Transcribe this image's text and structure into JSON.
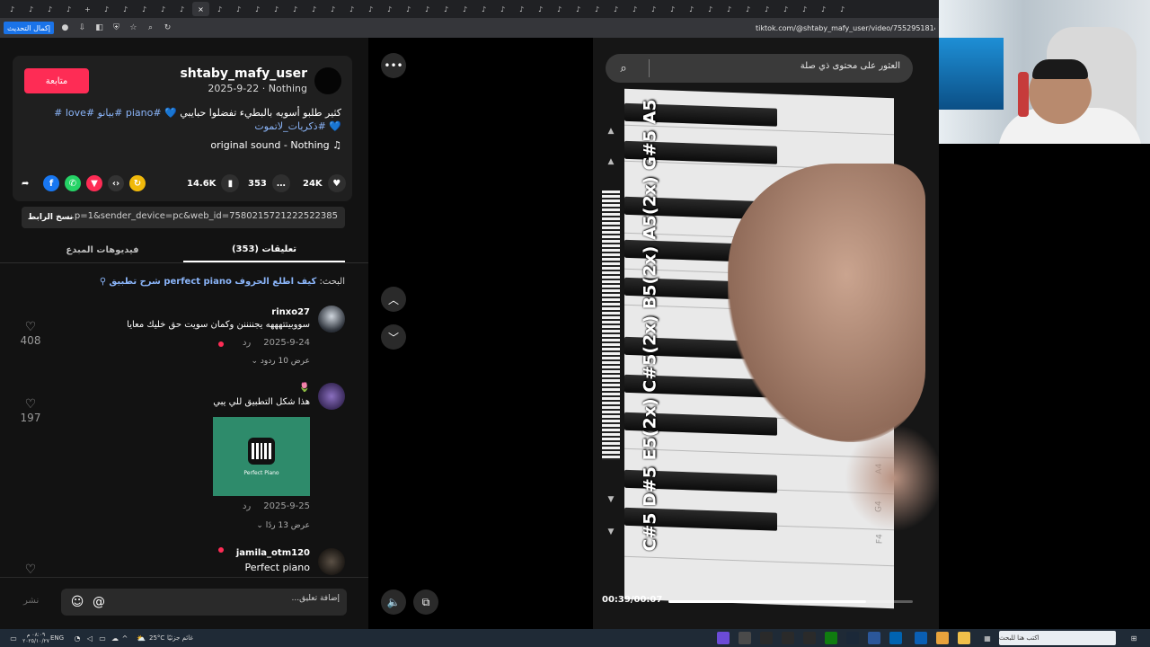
{
  "browser": {
    "update_button": "إكمال التحديث",
    "url": "tiktok.com/@shtaby_mafy_user/video/75529518147866657367",
    "tab_icon": "tiktok-icon",
    "active_tab_close": "×",
    "new_tab": "+"
  },
  "post": {
    "follow_label": "متابعة",
    "username": "shtaby_mafy_user",
    "date_line": "2025-9-22 · Nothing",
    "caption_text": "كثير طلبو أسويه بالبطيء تفضلوا حبايبي 💙",
    "caption_tags": "#piano #بيانو #love # 💙 #ذكريات_لاتموت",
    "sound": "original sound - Nothing",
    "sound_icon": "♫"
  },
  "stats": {
    "likes": "24K",
    "comments": "353",
    "saves": "14.6K"
  },
  "share": {
    "link": "...p=1&sender_device=pc&web_id=7580215721222522385",
    "copy_label": "نسخ الرابط"
  },
  "tabs": {
    "comments": "(353) تعليقات",
    "creator_videos": "فيديوهات المبدع"
  },
  "search_hint": {
    "prefix": "البحث:",
    "query": "كيف اطلع الحروف perfect piano شرح تطبيق"
  },
  "comments": [
    {
      "user": "rinxo27",
      "text": "سووبيتتهههه يجننننن وكمان سويت حق خليك معايا",
      "date": "2025-9-24",
      "reply": "رد",
      "replies": "عرض 10 ردود",
      "likes": "408"
    },
    {
      "user": "",
      "emoji": "🌷",
      "text": "هذا شكل التطبيق للي يبي",
      "card_label": "Perfect Piano",
      "date": "2025-9-25",
      "reply": "رد",
      "replies": "عرض 13 ردًا",
      "likes": "197"
    },
    {
      "user": "jamila_otm120",
      "text": "Perfect piano"
    }
  ],
  "composer": {
    "placeholder": "إضافة تعليق...",
    "post_label": "نشر"
  },
  "video": {
    "search_placeholder": "العثور على محتوى ذي صلة",
    "overlay_notes": "C#5 D#5 E5(2x) C#5(2x) B5(2x) A5(2x) G#5 A5",
    "time": "00:39/00:07",
    "progress": 0.81,
    "key_labels": [
      "B5",
      "C5",
      "A4",
      "G4",
      "F4"
    ]
  },
  "taskbar": {
    "search_placeholder": "اكتب هنا للبحث",
    "weather": "25°C",
    "weather_label": "غائم جزئيًا",
    "lang": "ENG",
    "time": "٠٨:٠٩ م",
    "date": "٢٠٢٥/١٠/٢٧"
  }
}
